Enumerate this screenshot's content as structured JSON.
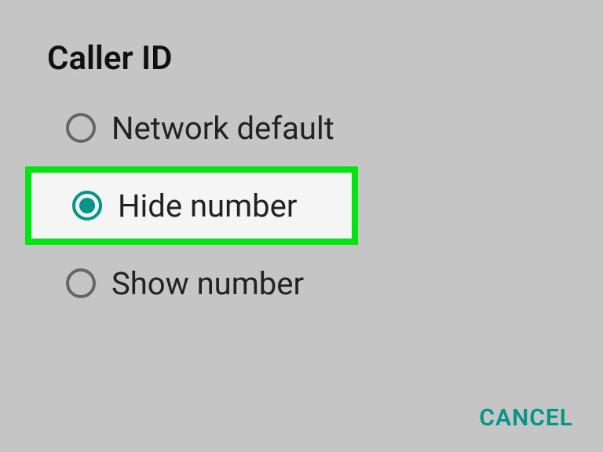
{
  "dialog": {
    "title": "Caller ID",
    "options": [
      {
        "label": "Network default",
        "selected": false,
        "highlighted": false
      },
      {
        "label": "Hide number",
        "selected": true,
        "highlighted": true
      },
      {
        "label": "Show number",
        "selected": false,
        "highlighted": false
      }
    ],
    "cancel_label": "CANCEL",
    "colors": {
      "accent": "#009688",
      "highlight_border": "#00e60f",
      "bg": "#c5c5c5"
    }
  }
}
